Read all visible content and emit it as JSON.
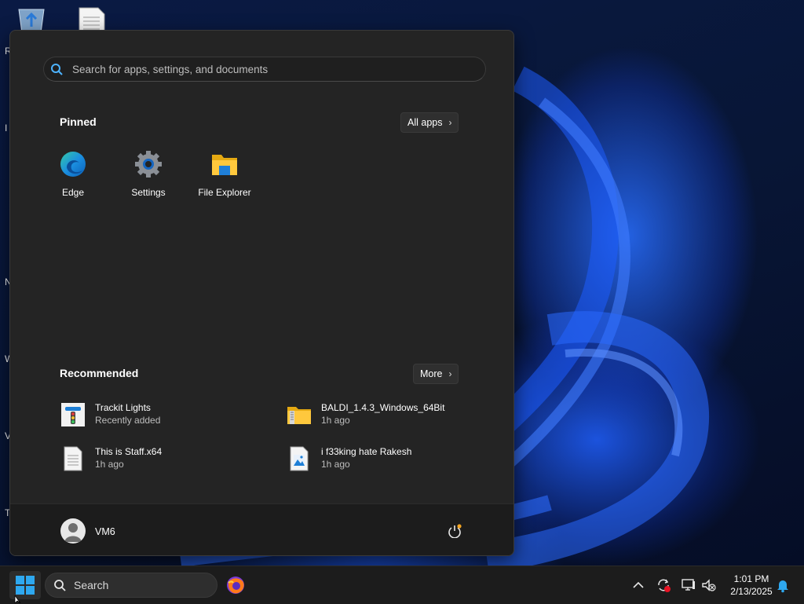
{
  "desktop": {
    "icons": [
      "recycle-bin-icon",
      "document-icon"
    ],
    "edge_letters": [
      "R",
      "I",
      "N",
      "W",
      "V",
      "Tr"
    ]
  },
  "start_menu": {
    "search_placeholder": "Search for apps, settings, and documents",
    "pinned": {
      "title": "Pinned",
      "all_apps_label": "All apps",
      "apps": [
        {
          "label": "Edge",
          "icon": "edge-icon"
        },
        {
          "label": "Settings",
          "icon": "settings-gear-icon"
        },
        {
          "label": "File Explorer",
          "icon": "folder-icon"
        }
      ]
    },
    "recommended": {
      "title": "Recommended",
      "more_label": "More",
      "items": [
        {
          "name": "Trackit Lights",
          "detail": "Recently added",
          "icon": "traffic-light-app-icon"
        },
        {
          "name": "BALDI_1.4.3_Windows_64Bit",
          "detail": "1h ago",
          "icon": "zip-folder-icon"
        },
        {
          "name": "This is Staff.x64",
          "detail": "1h ago",
          "icon": "file-icon"
        },
        {
          "name": "i f33king hate Rakesh",
          "detail": "1h ago",
          "icon": "image-file-icon"
        }
      ]
    },
    "user": {
      "name": "VM6"
    }
  },
  "taskbar": {
    "search_label": "Search",
    "time": "1:01 PM",
    "date": "2/13/2025"
  },
  "colors": {
    "accent": "#0a84d6",
    "menu_bg": "#242424",
    "taskbar_bg": "#1c1c1c"
  }
}
